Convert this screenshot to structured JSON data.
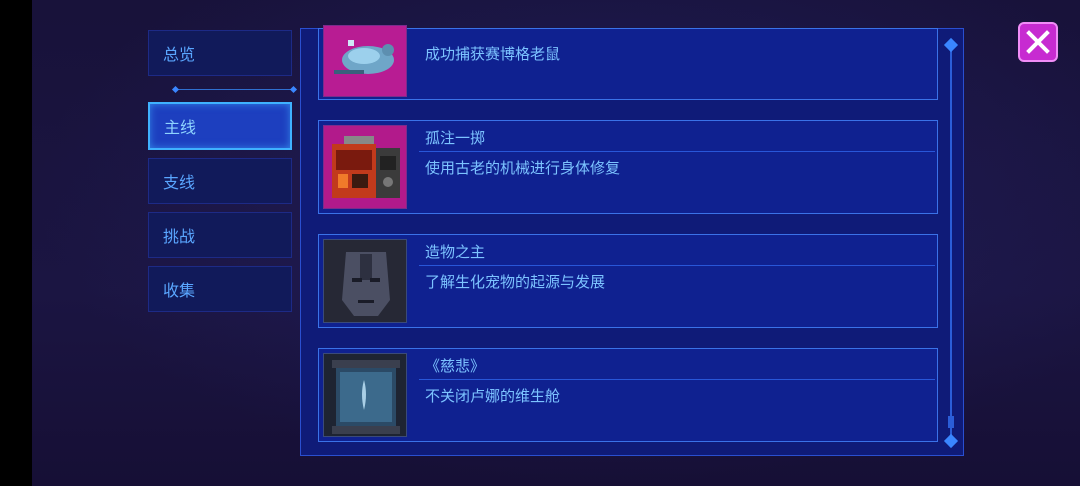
{
  "sidebar": {
    "tabs": [
      {
        "label": "总览"
      },
      {
        "label": "主线",
        "active": true
      },
      {
        "label": "支线"
      },
      {
        "label": "挑战"
      },
      {
        "label": "收集"
      }
    ]
  },
  "achievements": [
    {
      "title": "",
      "desc": "成功捕获赛博格老鼠",
      "icon": "cyber-rat-icon"
    },
    {
      "title": "孤注一掷",
      "desc": "使用古老的机械进行身体修复",
      "icon": "repair-machine-icon"
    },
    {
      "title": "造物之主",
      "desc": "了解生化宠物的起源与发展",
      "icon": "robot-face-icon"
    },
    {
      "title": "《慈悲》",
      "desc": "不关闭卢娜的维生舱",
      "icon": "life-pod-icon"
    }
  ],
  "colors": {
    "accent": "#3fb2ff",
    "close": "#c72bd1"
  }
}
